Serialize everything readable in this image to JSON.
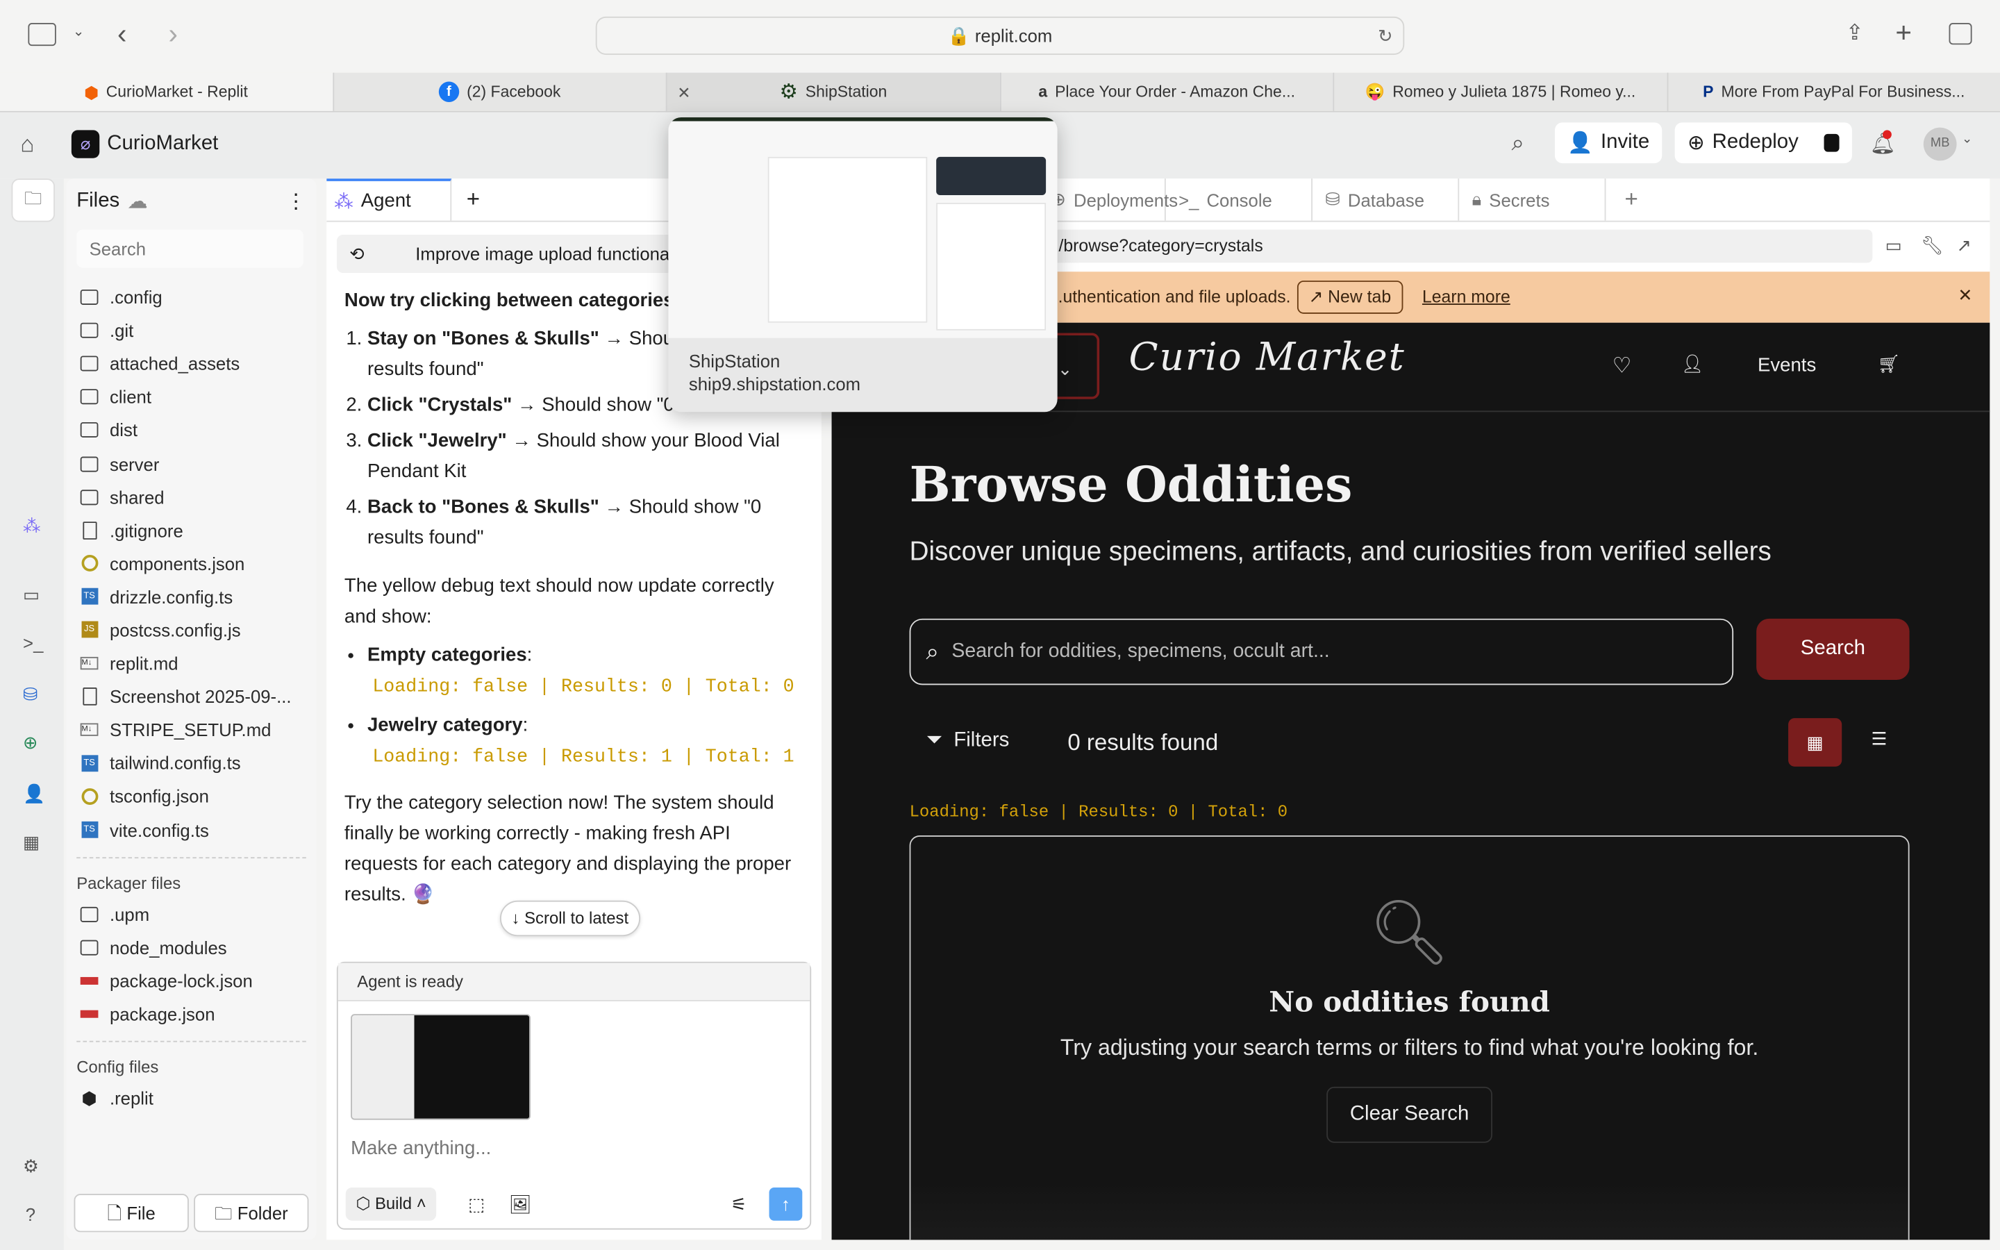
{
  "browser": {
    "url": "replit.com",
    "tabs": [
      {
        "label": "CurioMarket - Replit",
        "icon": "replit-icon"
      },
      {
        "label": "(2) Facebook",
        "icon": "facebook-icon"
      },
      {
        "label": "ShipStation",
        "icon": "shipstation-icon"
      },
      {
        "label": "Place Your Order - Amazon Che...",
        "icon": "amazon-icon"
      },
      {
        "label": "Romeo y Julieta 1875 | Romeo y...",
        "icon": "emoji-icon"
      },
      {
        "label": "More From PayPal For Business...",
        "icon": "paypal-icon"
      }
    ]
  },
  "tab_preview": {
    "title": "ShipStation",
    "domain": "ship9.shipstation.com"
  },
  "replit": {
    "project": "CurioMarket",
    "invite": "Invite",
    "redeploy": "Redeploy",
    "avatar": "MB"
  },
  "files": {
    "title": "Files",
    "search_placeholder": "Search",
    "items": [
      ".config",
      ".git",
      "attached_assets",
      "client",
      "dist",
      "server",
      "shared",
      ".gitignore",
      "components.json",
      "drizzle.config.ts",
      "postcss.config.js",
      "replit.md",
      "Screenshot 2025-09-...",
      "STRIPE_SETUP.md",
      "tailwind.config.ts",
      "tsconfig.json",
      "vite.config.ts"
    ],
    "packager_title": "Packager files",
    "packager_items": [
      ".upm",
      "node_modules",
      "package-lock.json",
      "package.json"
    ],
    "config_title": "Config files",
    "config_items": [
      ".replit"
    ],
    "new_file": "File",
    "new_folder": "Folder"
  },
  "agent": {
    "tab": "Agent",
    "history_title": "Improve image upload functional",
    "heading": "Now try clicking between categories",
    "steps": [
      {
        "b": "Stay on \"Bones & Skulls\"",
        "t": " → Should show \"0 results found\""
      },
      {
        "b": "Click \"Crystals\"",
        "t": " → Should show \"0 results found\""
      },
      {
        "b": "Click \"Jewelry\"",
        "t": " → Should show your Blood Vial Pendant Kit"
      },
      {
        "b": "Back to \"Bones & Skulls\"",
        "t": " → Should show \"0 results found\""
      }
    ],
    "para": "The yellow debug text should now update correctly and show:",
    "bullets": [
      {
        "b": "Empty categories",
        "code": "Loading: false | Results: 0 | Total: 0"
      },
      {
        "b": "Jewelry category",
        "code": "Loading: false | Results: 1 | Total: 1"
      }
    ],
    "closing": "Try the category selection now! The system should finally be working correctly - making fresh API requests for each category and displaying the proper results. 🔮",
    "scroll_latest": "Scroll to latest",
    "status": "Agent is ready",
    "input_placeholder": "Make anything...",
    "mode": "Build"
  },
  "preview": {
    "tabs": [
      "Deployments",
      "Console",
      "Database",
      "Secrets"
    ],
    "path": "/browse?category=crystals",
    "banner": "...uthentication and file uploads.",
    "new_tab": "New tab",
    "learn_more": "Learn more"
  },
  "site": {
    "logo": "Curio Market",
    "nav_events": "Events",
    "title": "Browse Oddities",
    "subtitle": "Discover unique specimens, artifacts, and curiosities from verified sellers",
    "search_placeholder": "Search for oddities, specimens, occult art...",
    "search_button": "Search",
    "filters": "Filters",
    "results": "0 results found",
    "debug": "Loading: false | Results: 0 | Total: 0",
    "empty_title": "No oddities found",
    "empty_text": "Try adjusting your search terms or filters to find what you're looking for.",
    "clear": "Clear Search",
    "accent": "#7a1d1d",
    "debug_color": "#d4a20a"
  }
}
